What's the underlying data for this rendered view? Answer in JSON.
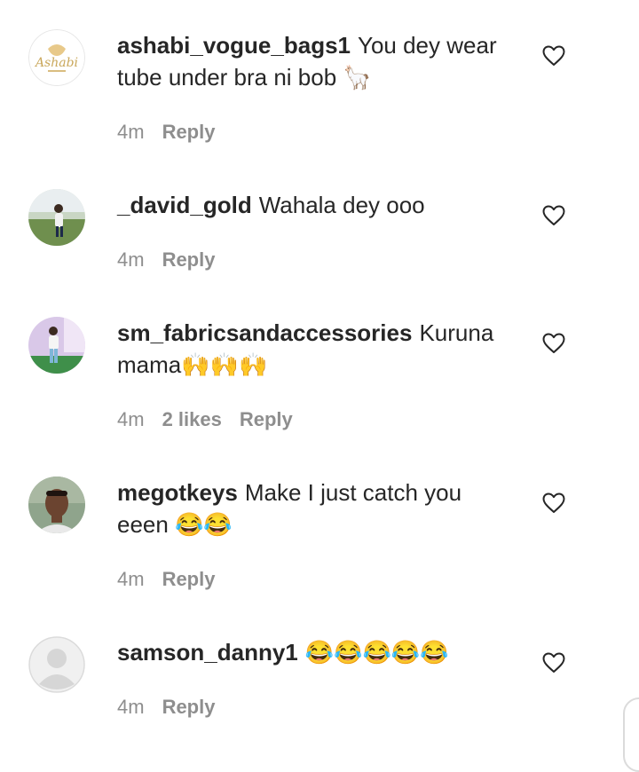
{
  "comments": [
    {
      "username": "ashabi_vogue_bags1",
      "text": "You dey wear tube under bra ni bob 🦙",
      "time": "4m",
      "likes": "",
      "reply": "Reply",
      "avatar": "ashabi-logo-avatar"
    },
    {
      "username": "_david_gold",
      "text": "Wahala dey ooo",
      "time": "4m",
      "likes": "",
      "reply": "Reply",
      "avatar": "photo-avatar"
    },
    {
      "username": "sm_fabricsandaccessories",
      "text": "Kuruna mama🙌🙌🙌",
      "time": "4m",
      "likes": "2 likes",
      "reply": "Reply",
      "avatar": "photo-avatar"
    },
    {
      "username": "megotkeys",
      "text": "Make I just catch you eeen 😂😂",
      "time": "4m",
      "likes": "",
      "reply": "Reply",
      "avatar": "photo-avatar"
    },
    {
      "username": "samson_danny1",
      "text": "😂😂😂😂😂",
      "time": "4m",
      "likes": "",
      "reply": "Reply",
      "avatar": "default-avatar"
    }
  ],
  "colors": {
    "text": "#262626",
    "meta": "#8e8e8e",
    "heart_outline": "#262626"
  },
  "icons": {
    "like": "heart-outline-icon"
  }
}
